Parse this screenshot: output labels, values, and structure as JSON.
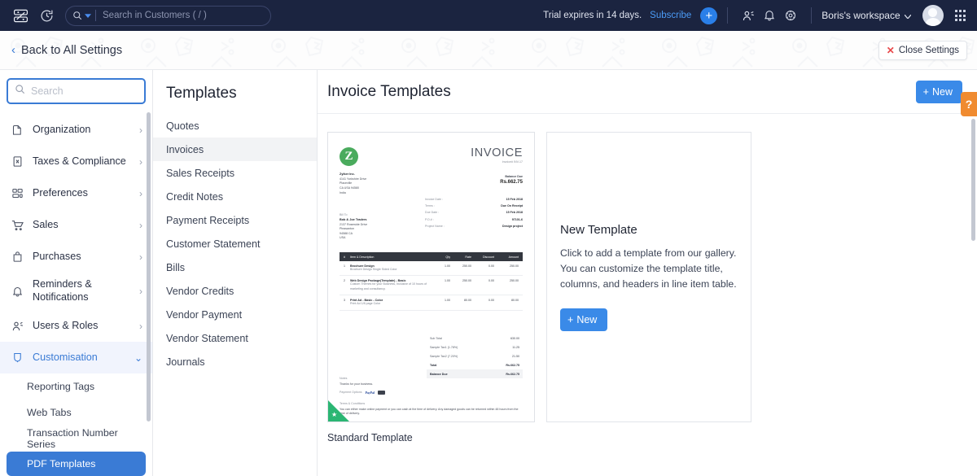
{
  "topbar": {
    "logo_icon": "zoho-books-logo-icon",
    "clock_icon": "recent-history-icon",
    "search": {
      "placeholder": "Search in Customers ( / )",
      "value": "",
      "icon": "search-icon",
      "caret_icon": "chevron-down-icon"
    },
    "trial_text": "Trial expires in 14 days.",
    "subscribe_label": "Subscribe",
    "quick_add_label": "+",
    "referral_icon": "people-icon",
    "notification_icon": "bell-icon",
    "settings_icon": "gear-icon",
    "workspace_label": "Boris's workspace",
    "workspace_caret": "chevron-down-icon",
    "avatar_icon": "user-avatar",
    "apps_icon": "grid-apps-icon"
  },
  "settingsbar": {
    "back_label": "Back to All Settings",
    "back_icon": "chevron-left-icon",
    "close_label": "Close Settings",
    "close_icon": "close-x-icon"
  },
  "sidebar": {
    "search_placeholder": "Search",
    "search_value": "",
    "search_icon": "search-icon",
    "items": [
      {
        "label": "Organization",
        "icon": "organization-icon",
        "chevron": "›",
        "active": false
      },
      {
        "label": "Taxes & Compliance",
        "icon": "tax-document-icon",
        "chevron": "›",
        "active": false
      },
      {
        "label": "Preferences",
        "icon": "preferences-icon",
        "chevron": "›",
        "active": false
      },
      {
        "label": "Sales",
        "icon": "cart-icon",
        "chevron": "›",
        "active": false
      },
      {
        "label": "Purchases",
        "icon": "bag-icon",
        "chevron": "›",
        "active": false
      },
      {
        "label": "Reminders & Notifications",
        "icon": "bell-icon",
        "chevron": "›",
        "active": false
      },
      {
        "label": "Users & Roles",
        "icon": "users-icon",
        "chevron": "›",
        "active": false
      },
      {
        "label": "Customisation",
        "icon": "customisation-icon",
        "chevron": "⌄",
        "active": true
      }
    ],
    "sub_items": [
      {
        "label": "Reporting Tags",
        "selected": false
      },
      {
        "label": "Web Tabs",
        "selected": false
      },
      {
        "label": "Transaction Number Series",
        "selected": false
      },
      {
        "label": "PDF Templates",
        "selected": true
      }
    ]
  },
  "templates_panel": {
    "title": "Templates",
    "items": [
      {
        "label": "Quotes",
        "active": false
      },
      {
        "label": "Invoices",
        "active": true
      },
      {
        "label": "Sales Receipts",
        "active": false
      },
      {
        "label": "Credit Notes",
        "active": false
      },
      {
        "label": "Payment Receipts",
        "active": false
      },
      {
        "label": "Customer Statement",
        "active": false
      },
      {
        "label": "Bills",
        "active": false
      },
      {
        "label": "Vendor Credits",
        "active": false
      },
      {
        "label": "Vendor Payment",
        "active": false
      },
      {
        "label": "Vendor Statement",
        "active": false
      },
      {
        "label": "Journals",
        "active": false
      }
    ]
  },
  "main": {
    "title": "Invoice Templates",
    "new_button_label": "New",
    "new_button_icon": "plus-icon",
    "help_tab_label": "?",
    "template_card": {
      "caption": "Standard Template"
    },
    "new_template_card": {
      "heading": "New Template",
      "description": "Click to add a template from our gallery. You can customize the template title, columns, and headers in line item table.",
      "button_label": "New",
      "button_icon": "plus-icon"
    }
  },
  "invoice_preview": {
    "logo_letter": "Z",
    "heading": "INVOICE",
    "invoice_number": "Invoice# INV-17",
    "balance_label": "Balance Due",
    "balance_value": "Rs.662.75",
    "from": {
      "company": "Zylker Inc.",
      "lines": [
        "4141 Yorkshire Drive",
        "Placeville",
        "CA USA 94580",
        "India"
      ]
    },
    "bill_to_label": "Bill To",
    "bill_to": {
      "name": "Bob & Joe Traders",
      "lines": [
        "2137 Rosewide Drive",
        "Pleasanton",
        "94588 CA",
        "USA"
      ]
    },
    "meta": [
      {
        "label": "Invoice Date :",
        "value": "15 Feb 2018"
      },
      {
        "label": "Terms :",
        "value": "Due On Receipt"
      },
      {
        "label": "Due Date :",
        "value": "15 Feb 2018"
      },
      {
        "label": "P.O.# :",
        "value": "97101-6"
      },
      {
        "label": "Project Name :",
        "value": "Design project"
      }
    ],
    "table_headers": [
      "#",
      "Item & Description",
      "Qty",
      "Rate",
      "Discount",
      "Amount"
    ],
    "table_rows": [
      {
        "n": "1",
        "name": "Brochure Design",
        "desc": "Brochure Design Single Sided Color",
        "qty": "1.00",
        "rate": "250.00",
        "discount": "0.00",
        "amount": "250.00"
      },
      {
        "n": "2",
        "name": "Web Design Package(Template) - Basic",
        "desc": "Custom Themes for your Business, Inclusive of 10 hours of marketing and consultancy.",
        "qty": "1.00",
        "rate": "250.00",
        "discount": "0.00",
        "amount": "250.00"
      },
      {
        "n": "3",
        "name": "Print Ad - Basic - Color",
        "desc": "Print Ad 1/8 page Color",
        "qty": "1.00",
        "rate": "80.00",
        "discount": "0.00",
        "amount": "80.00"
      }
    ],
    "totals": [
      {
        "label": "Sub Total",
        "value": "630.00",
        "style": "normal"
      },
      {
        "label": "Sample Tax1 (1.78%)",
        "value": "11.25",
        "style": "normal"
      },
      {
        "label": "Sample Tax2 (7.20%)",
        "value": "21.50",
        "style": "normal"
      },
      {
        "label": "Total",
        "value": "Rs.662.75",
        "style": "bold"
      },
      {
        "label": "Balance Due",
        "value": "Rs.662.75",
        "style": "bal"
      }
    ],
    "notes_label": "Notes",
    "notes_text": "Thanks for your business.",
    "payment_label": "Payment Options",
    "paypal_label": "PayPal",
    "terms_label": "Terms & Conditions",
    "terms_text": "You can either make online payment or you can cash at the time of delivery. Any damaged goods can be returned within 48 hours from the time of delivery."
  },
  "colors": {
    "topbar_bg": "#1b2440",
    "accent_blue": "#3a8ae8",
    "active_blue": "#3a7bd5",
    "help_orange": "#f08b30",
    "close_red": "#e8484a",
    "logo_green": "#4aab5d",
    "ribbon_green": "#2bb673"
  }
}
